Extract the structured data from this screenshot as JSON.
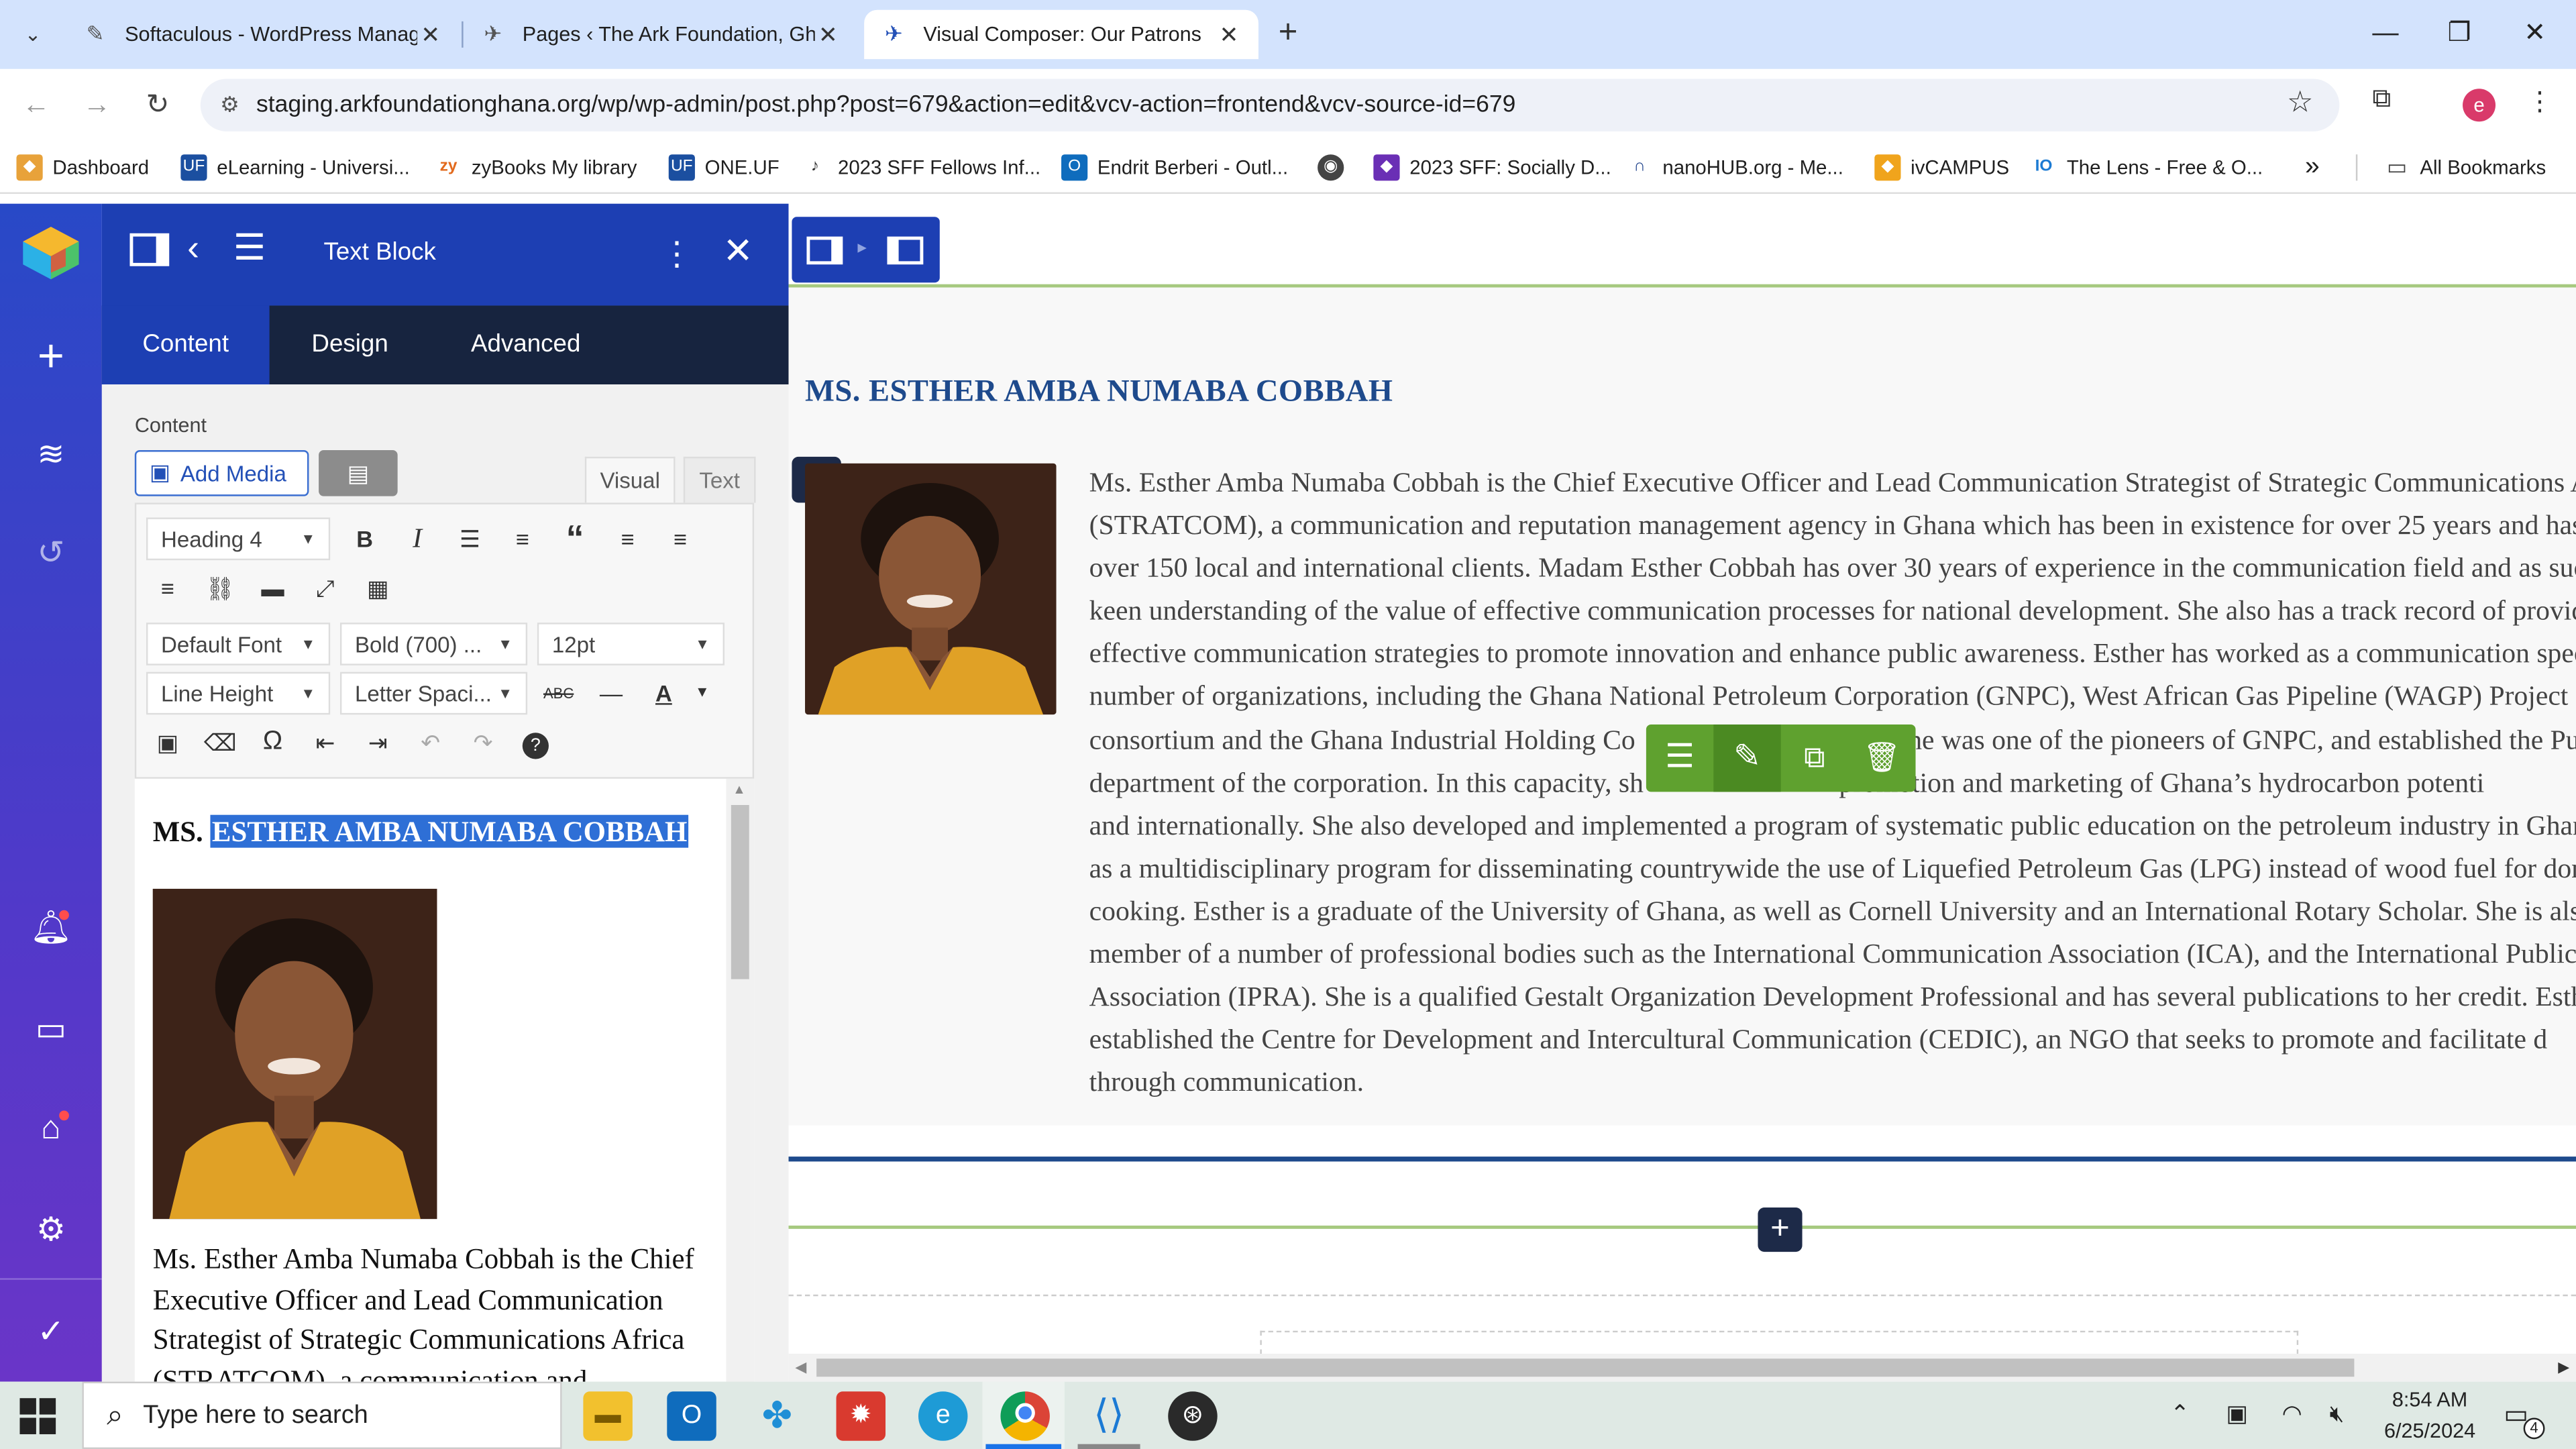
{
  "browser": {
    "tabs": [
      {
        "title": "Softaculous - WordPress Manag",
        "icon": "softaculous-icon"
      },
      {
        "title": "Pages ‹ The Ark Foundation, Gh",
        "icon": "ark-favicon"
      },
      {
        "title": "Visual Composer: Our Patrons",
        "icon": "ark-favicon",
        "active": true
      }
    ],
    "new_tab": "+",
    "url": "staging.arkfoundationghana.org/wp/wp-admin/post.php?post=679&action=edit&vcv-action=frontend&vcv-source-id=679",
    "profile_initial": "e",
    "bookmarks": [
      {
        "label": "Dashboard",
        "icon": "dashboard-icon"
      },
      {
        "label": "eLearning - Universi...",
        "icon": "uf-icon"
      },
      {
        "label": "zyBooks My library",
        "icon": "zy-icon"
      },
      {
        "label": "ONE.UF",
        "icon": "uf-icon"
      },
      {
        "label": "2023 SFF Fellows Inf...",
        "icon": "doc-icon"
      },
      {
        "label": "Endrit Berberi - Outl...",
        "icon": "outlook-icon"
      },
      {
        "label": "",
        "icon": "globe-icon"
      },
      {
        "label": "2023 SFF: Socially D...",
        "icon": "cube-icon"
      },
      {
        "label": "nanoHUB.org - Me...",
        "icon": "nano-icon"
      },
      {
        "label": "ivCAMPUS",
        "icon": "campus-icon"
      },
      {
        "label": "The Lens - Free & O...",
        "icon": "lens-icon"
      }
    ],
    "bookmarks_overflow": "»",
    "all_bookmarks": "All Bookmarks"
  },
  "panel": {
    "title": "Text Block",
    "tabs": [
      "Content",
      "Design",
      "Advanced"
    ],
    "section_label": "Content",
    "add_media": "Add Media",
    "editor_tabs": [
      "Visual",
      "Text"
    ],
    "format_select": "Heading 4",
    "font_select": "Default Font",
    "weight_select": "Bold (700) ...",
    "size_select": "12pt",
    "line_height_select": "Line Height",
    "letter_spacing_select": "Letter Spaci...",
    "editor_heading_prefix": "MS.",
    "editor_heading_selected": "ESTHER AMBA NUMABA COBBAH",
    "editor_paragraph_lines": [
      "Ms. Esther Amba Numaba Cobbah is the Chief",
      "Executive Officer and Lead Communication",
      "Strategist of Strategic Communications Africa",
      "(STRATCOM), a communication and"
    ]
  },
  "canvas": {
    "heading": "MS. ESTHER AMBA NUMABA COBBAH",
    "bio_lines": [
      "Ms. Esther Amba Numaba Cobbah is the Chief Executive Officer and Lead Communication Strategist of Strategic Communications Africa",
      "(STRATCOM), a communication and reputation management agency in Ghana which has been in existence for over 25 years and has",
      "over 150 local and international clients. Madam Esther Cobbah has over 30 years of experience in the communication field and as such",
      "keen understanding of the value of effective communication processes for national development. She also has a track record of providing",
      "effective communication strategies to promote innovation and enhance public awareness. Esther has worked as a communication specialist",
      "number of organizations, including the Ghana National Petroleum Corporation (GNPC), West African Gas Pipeline (WAGP) Project",
      "consortium and the Ghana Industrial Holding Corporation. She was one of the pioneers of GNPC, and established the Public",
      "department of the corporation. In this capacity, she keenly supported the promotion and marketing of Ghana’s hydrocarbon potential",
      "and internationally. She also developed and implemented a program of systematic public education on the petroleum industry in Ghana",
      "as a multidisciplinary program for disseminating countrywide the use of Liquefied Petroleum Gas (LPG) instead of wood fuel for domestic",
      "cooking. Esther is a graduate of the University of Ghana, as well as Cornell University and an International Rotary Scholar. She is also a",
      "member of a number of professional bodies such as the International Communication Association (ICA), and the International Public",
      "Association (IPRA). She is a qualified Gestalt Organization Development Professional and has several publications to her credit. Esther",
      "established the Centre for Development and Intercultural Communication (CEDIC), an NGO that seeks to promote and facilitate d",
      "through communication."
    ],
    "bio_line_7_a": "consortium and the Ghana Industrial Holding Co",
    "bio_line_7_b": "he was one of the pioneers of GNPC, and established the Pu",
    "bio_line_8_a": "department of the corporation. In this capacity, sh",
    "bio_line_8_b": "promotion and marketing of Ghana’s hydrocarbon potenti"
  },
  "taskbar": {
    "search_placeholder": "Type here to search",
    "time": "8:54 AM",
    "date": "6/25/2024",
    "notifications": "4"
  },
  "colors": {
    "accent_blue": "#1d3fb3",
    "heading_blue": "#1e4a8c",
    "toolbar_green": "#5fa12f",
    "selection": "#2e6fd6"
  }
}
